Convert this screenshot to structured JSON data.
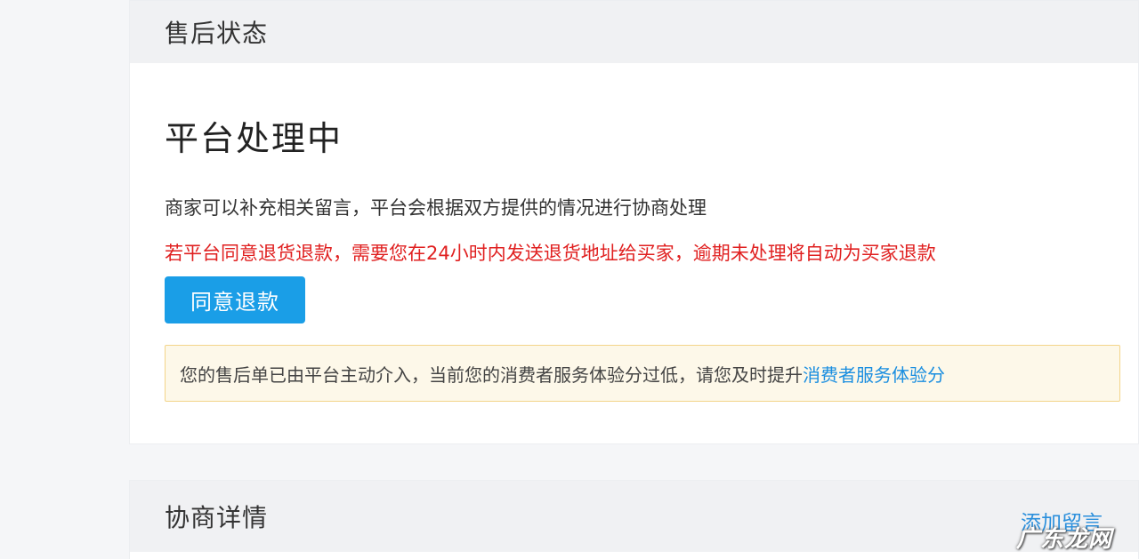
{
  "status_card": {
    "header_title": "售后状态",
    "big_title": "平台处理中",
    "description": "商家可以补充相关留言，平台会根据双方提供的情况进行协商处理",
    "warning": "若平台同意退货退款，需要您在24小时内发送退货地址给买家，逾期未处理将自动为买家退款",
    "agree_button": "同意退款",
    "notice_text": "您的售后单已由平台主动介入，当前您的消费者服务体验分过低，请您及时提升",
    "notice_link": "消费者服务体验分"
  },
  "detail_card": {
    "header_title": "协商详情",
    "add_comment": "添加留言"
  },
  "watermark": "广东龙网",
  "colors": {
    "primary_button": "#1a9ee7",
    "warning_text": "#e02020",
    "link": "#1a8ee0",
    "notice_bg": "#fdf8e9",
    "notice_border": "#f3d48a"
  }
}
